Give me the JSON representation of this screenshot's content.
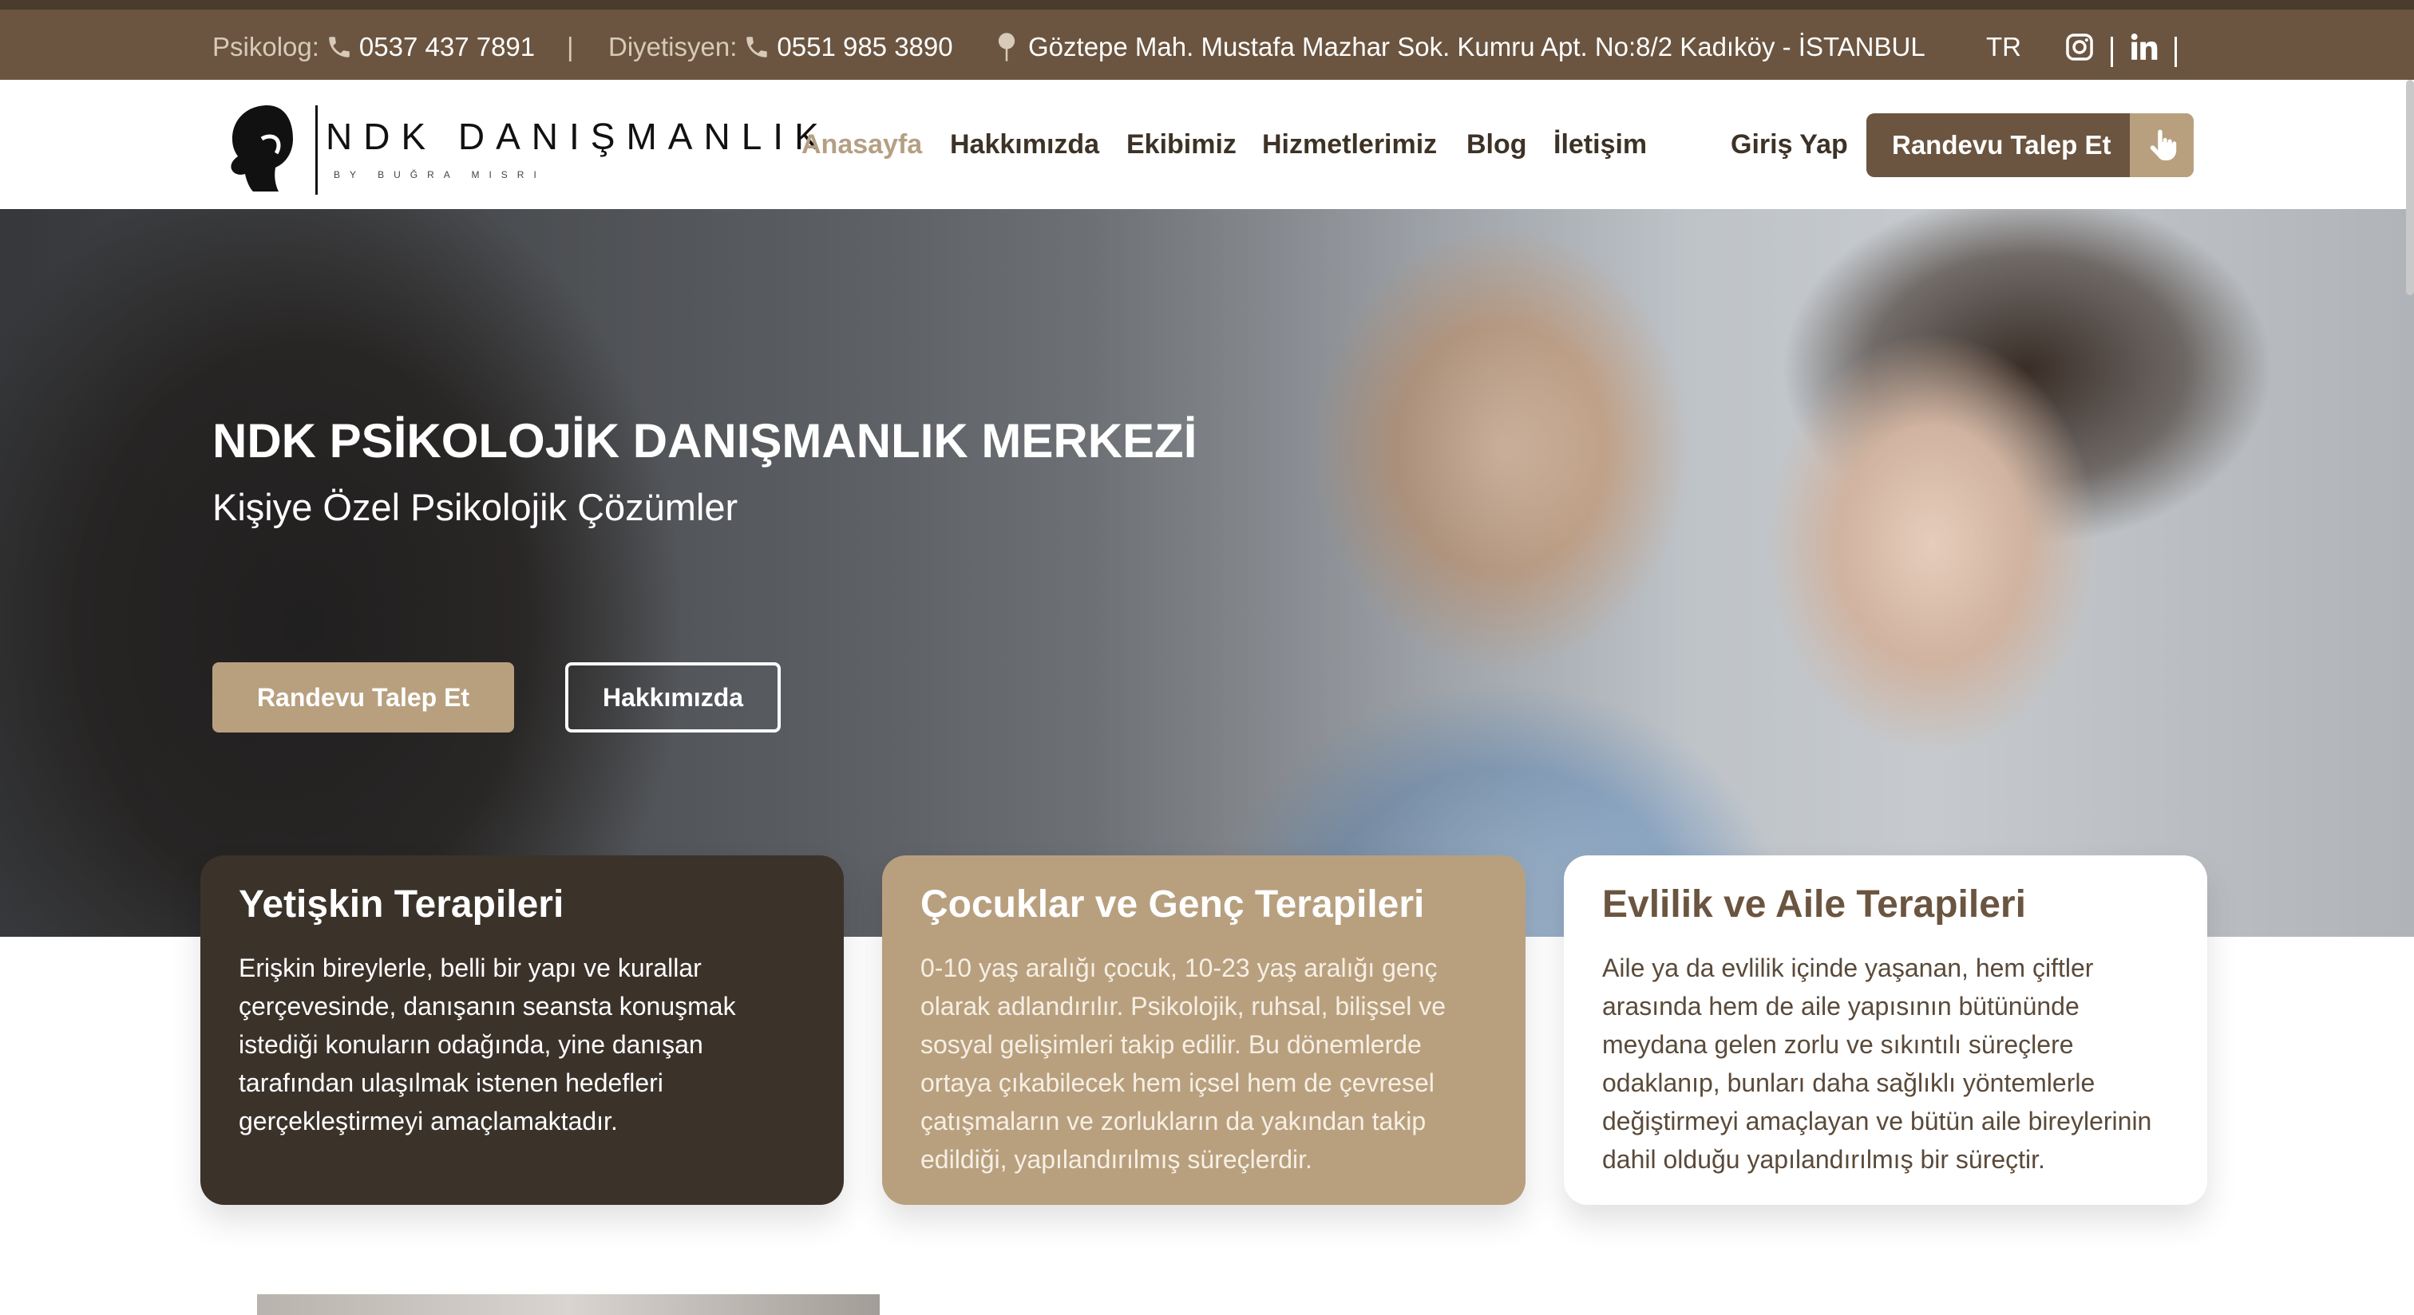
{
  "topbar": {
    "psikolog_label": "Psikolog:",
    "psikolog_phone": "0537 437 7891",
    "separator": "|",
    "diyetisyen_label": "Diyetisyen:",
    "diyetisyen_phone": "0551 985 3890",
    "address": "Göztepe Mah. Mustafa Mazhar Sok. Kumru Apt. No:8/2 Kadıköy - İSTANBUL",
    "language": "TR",
    "icons": [
      "phone-icon",
      "map-pin-icon",
      "instagram-icon",
      "linkedin-icon"
    ]
  },
  "header": {
    "logo_text": "NDK DANIŞMANLIK",
    "logo_sub": "BY BUĞRA MISRI",
    "nav": [
      "Anasayfa",
      "Hakkımızda",
      "Ekibimiz",
      "Hizmetlerimiz",
      "Blog",
      "İletişim"
    ],
    "active_nav": "Anasayfa",
    "login": "Giriş Yap",
    "cta": "Randevu Talep Et"
  },
  "hero": {
    "title": "NDK PSİKOLOJİK DANIŞMANLIK MERKEZİ",
    "subtitle": "Kişiye Özel Psikolojik Çözümler",
    "primary_button": "Randevu Talep Et",
    "secondary_button": "Hakkımızda"
  },
  "cards": [
    {
      "title": "Yetişkin Terapileri",
      "text": "Erişkin bireylerle, belli bir yapı ve kurallar çerçevesinde, danışanın seansta konuşmak istediği konuların odağında, yine danışan tarafından ulaşılmak istenen hedefleri gerçekleştirmeyi amaçlamaktadır."
    },
    {
      "title": "Çocuklar ve Genç Terapileri",
      "text": "0-10 yaş aralığı çocuk, 10-23 yaş aralığı genç olarak adlandırılır. Psikolojik, ruhsal, bilişsel ve sosyal gelişimleri takip edilir. Bu dönemlerde ortaya çıkabilecek hem içsel hem de çevresel çatışmaların ve zorlukların da yakından takip edildiği, yapılandırılmış süreçlerdir."
    },
    {
      "title": "Evlilik ve Aile Terapileri",
      "text": "Aile ya da evlilik içinde yaşanan, hem çiftler arasında hem de aile yapısının bütününde meydana gelen zorlu ve sıkıntılı süreçlere odaklanıp, bunları daha sağlıklı yöntemlerle değiştirmeyi amaçlayan ve bütün aile bireylerinin dahil olduğu yapılandırılmış bir süreçtir."
    }
  ],
  "colors": {
    "brand_dark": "#6b5540",
    "brand_tan": "#b8a07f",
    "card_dark": "#3b322a"
  }
}
